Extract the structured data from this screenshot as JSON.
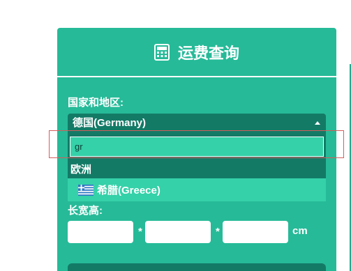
{
  "header": {
    "title": "运费查询",
    "icon": "calculator-icon"
  },
  "region": {
    "label": "国家和地区:",
    "selected": "德国(Germany)",
    "search_value": "gr",
    "group_label": "欧洲",
    "option_label": "希腊(Greece)",
    "option_flag": "greece-flag-icon"
  },
  "dimensions": {
    "label": "长宽高:",
    "separator_1": "*",
    "separator_2": "*",
    "unit": "cm"
  },
  "colors": {
    "panel": "#26ba98",
    "dark": "#137a66",
    "highlight": "#35d1a8"
  }
}
